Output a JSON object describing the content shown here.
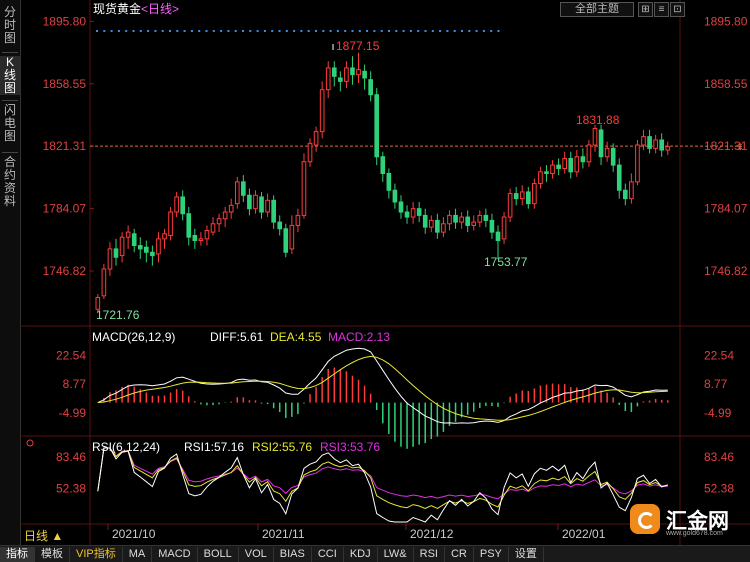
{
  "sidebar": {
    "tabs": [
      {
        "label": "分时图",
        "active": false
      },
      {
        "label": "K线图",
        "active": true
      },
      {
        "label": "闪电图",
        "active": false
      },
      {
        "label": "合约资料",
        "active": false
      }
    ]
  },
  "header": {
    "instrument": "现货黄金",
    "period_tag": "<日线>",
    "theme_select": "全部主题",
    "win_buttons": [
      "⊞",
      "≡",
      "⊡"
    ]
  },
  "colors": {
    "up": "#ff3b3b",
    "down": "#2fd27a",
    "axis_label": "#e04040",
    "grid": "#7a1a1a",
    "dif": "#ffffff",
    "dea": "#e8e830",
    "macd": "#e030e0",
    "rsi1": "#ffffff",
    "rsi2": "#e8e830",
    "rsi3": "#e030e0",
    "dots": "#3a8ee8"
  },
  "main_panel": {
    "y_labels": [
      "1895.80",
      "1858.55",
      "1821.31",
      "1784.07",
      "1746.82"
    ],
    "current_price_label": "1821.31",
    "annotations": {
      "high": "1877.15",
      "low": "1721.76",
      "mid_low": "1753.77",
      "mid_high": "1831.88"
    }
  },
  "macd_panel": {
    "title": "MACD(26,12,9)",
    "diff": "DIFF:5.61",
    "dea": "DEA:4.55",
    "macd": "MACD:2.13",
    "y_labels": [
      "22.54",
      "8.77",
      "-4.99"
    ]
  },
  "rsi_panel": {
    "title": "RSI(6,12,24)",
    "rsi1": "RSI1:57.16",
    "rsi2": "RSI2:55.76",
    "rsi3": "RSI3:53.76",
    "y_labels": [
      "83.46",
      "52.38"
    ]
  },
  "x_axis": {
    "labels": [
      "2021/10",
      "2021/11",
      "2021/12",
      "2022/01"
    ]
  },
  "period_button": "日线 ▲",
  "bottom_tabs": [
    "指标",
    "模板",
    "VIP指标",
    "MA",
    "MACD",
    "BOLL",
    "VOL",
    "BIAS",
    "CCI",
    "KDJ",
    "LW&",
    "RSI",
    "CR",
    "PSY",
    "设置"
  ],
  "logo": {
    "name": "汇金网",
    "url": "www.gold678.com"
  },
  "chart_data": {
    "type": "candlestick",
    "ylim": [
      1721.76,
      1895.8
    ],
    "x_labels": [
      "2021/10",
      "2021/11",
      "2021/12",
      "2022/01"
    ],
    "candles": [
      [
        1724,
        1731,
        1721.76,
        1733
      ],
      [
        1732,
        1748,
        1730,
        1751
      ],
      [
        1748,
        1760,
        1744,
        1764
      ],
      [
        1760,
        1755,
        1750,
        1766
      ],
      [
        1756,
        1767,
        1752,
        1770
      ],
      [
        1767,
        1770,
        1760,
        1774
      ],
      [
        1769,
        1762,
        1758,
        1772
      ],
      [
        1762,
        1760,
        1754,
        1767
      ],
      [
        1761,
        1758,
        1752,
        1765
      ],
      [
        1758,
        1756,
        1750,
        1762
      ],
      [
        1757,
        1766,
        1752,
        1770
      ],
      [
        1766,
        1769,
        1760,
        1772
      ],
      [
        1768,
        1782,
        1765,
        1785
      ],
      [
        1782,
        1791,
        1779,
        1794
      ],
      [
        1791,
        1781,
        1777,
        1795
      ],
      [
        1781,
        1767,
        1762,
        1785
      ],
      [
        1768,
        1765,
        1760,
        1772
      ],
      [
        1765,
        1766,
        1762,
        1770
      ],
      [
        1766,
        1771,
        1762,
        1774
      ],
      [
        1770,
        1775,
        1768,
        1779
      ],
      [
        1775,
        1778,
        1770,
        1781
      ],
      [
        1778,
        1782,
        1773,
        1785
      ],
      [
        1782,
        1786,
        1778,
        1790
      ],
      [
        1787,
        1800,
        1784,
        1803
      ],
      [
        1800,
        1792,
        1788,
        1804
      ],
      [
        1792,
        1784,
        1780,
        1796
      ],
      [
        1784,
        1792,
        1781,
        1795
      ],
      [
        1791,
        1782,
        1778,
        1794
      ],
      [
        1782,
        1789,
        1779,
        1793
      ],
      [
        1789,
        1776,
        1772,
        1792
      ],
      [
        1776,
        1772,
        1768,
        1780
      ],
      [
        1772,
        1758,
        1755,
        1775
      ],
      [
        1760,
        1774,
        1757,
        1780
      ],
      [
        1774,
        1780,
        1770,
        1784
      ],
      [
        1780,
        1812,
        1778,
        1817
      ],
      [
        1812,
        1823,
        1809,
        1826
      ],
      [
        1822,
        1830,
        1818,
        1833
      ],
      [
        1830,
        1855,
        1826,
        1860
      ],
      [
        1855,
        1868,
        1850,
        1872
      ],
      [
        1868,
        1863,
        1857,
        1872
      ],
      [
        1862,
        1860,
        1854,
        1866
      ],
      [
        1860,
        1868,
        1856,
        1872
      ],
      [
        1868,
        1864,
        1858,
        1875
      ],
      [
        1864,
        1867,
        1859,
        1877.15
      ],
      [
        1866,
        1862,
        1855,
        1870
      ],
      [
        1861,
        1852,
        1848,
        1866
      ],
      [
        1852,
        1815,
        1810,
        1856
      ],
      [
        1815,
        1805,
        1800,
        1818
      ],
      [
        1805,
        1795,
        1790,
        1808
      ],
      [
        1795,
        1788,
        1784,
        1799
      ],
      [
        1788,
        1782,
        1778,
        1792
      ],
      [
        1782,
        1779,
        1775,
        1786
      ],
      [
        1779,
        1784,
        1775,
        1788
      ],
      [
        1784,
        1780,
        1776,
        1788
      ],
      [
        1780,
        1773,
        1769,
        1784
      ],
      [
        1773,
        1777,
        1770,
        1780
      ],
      [
        1777,
        1770,
        1766,
        1781
      ],
      [
        1770,
        1775,
        1767,
        1779
      ],
      [
        1775,
        1780,
        1771,
        1783
      ],
      [
        1780,
        1776,
        1772,
        1784
      ],
      [
        1776,
        1779,
        1772,
        1782
      ],
      [
        1779,
        1774,
        1770,
        1783
      ],
      [
        1774,
        1776,
        1771,
        1780
      ],
      [
        1776,
        1780,
        1773,
        1783
      ],
      [
        1780,
        1777,
        1773,
        1784
      ],
      [
        1777,
        1770,
        1766,
        1781
      ],
      [
        1770,
        1765,
        1753.77,
        1774
      ],
      [
        1766,
        1779,
        1763,
        1782
      ],
      [
        1779,
        1793,
        1776,
        1796
      ],
      [
        1793,
        1790,
        1786,
        1797
      ],
      [
        1790,
        1794,
        1786,
        1798
      ],
      [
        1794,
        1787,
        1784,
        1797
      ],
      [
        1787,
        1799,
        1784,
        1802
      ],
      [
        1799,
        1806,
        1796,
        1809
      ],
      [
        1806,
        1805,
        1800,
        1810
      ],
      [
        1805,
        1810,
        1802,
        1813
      ],
      [
        1810,
        1808,
        1804,
        1814
      ],
      [
        1808,
        1814,
        1805,
        1818
      ],
      [
        1814,
        1806,
        1802,
        1818
      ],
      [
        1806,
        1815,
        1803,
        1819
      ],
      [
        1815,
        1812,
        1808,
        1820
      ],
      [
        1812,
        1822,
        1809,
        1825
      ],
      [
        1822,
        1831.88,
        1818,
        1834
      ],
      [
        1831,
        1815,
        1810,
        1834
      ],
      [
        1815,
        1820,
        1812,
        1824
      ],
      [
        1820,
        1810,
        1806,
        1823
      ],
      [
        1810,
        1795,
        1790,
        1814
      ],
      [
        1795,
        1790,
        1786,
        1799
      ],
      [
        1790,
        1800,
        1787,
        1805
      ],
      [
        1800,
        1822,
        1798,
        1825
      ],
      [
        1822,
        1827,
        1819,
        1831
      ],
      [
        1827,
        1820,
        1817,
        1831
      ],
      [
        1820,
        1825,
        1817,
        1828
      ],
      [
        1825,
        1819,
        1815,
        1829
      ],
      [
        1819,
        1821,
        1816,
        1824
      ]
    ],
    "macd": {
      "y_labels": [
        22.54,
        8.77,
        -4.99
      ],
      "dif_last": 5.61,
      "dea_last": 4.55,
      "macd_last": 2.13
    },
    "rsi": {
      "y_labels": [
        83.46,
        52.38
      ],
      "rsi1_last": 57.16,
      "rsi2_last": 55.76,
      "rsi3_last": 53.76
    }
  }
}
